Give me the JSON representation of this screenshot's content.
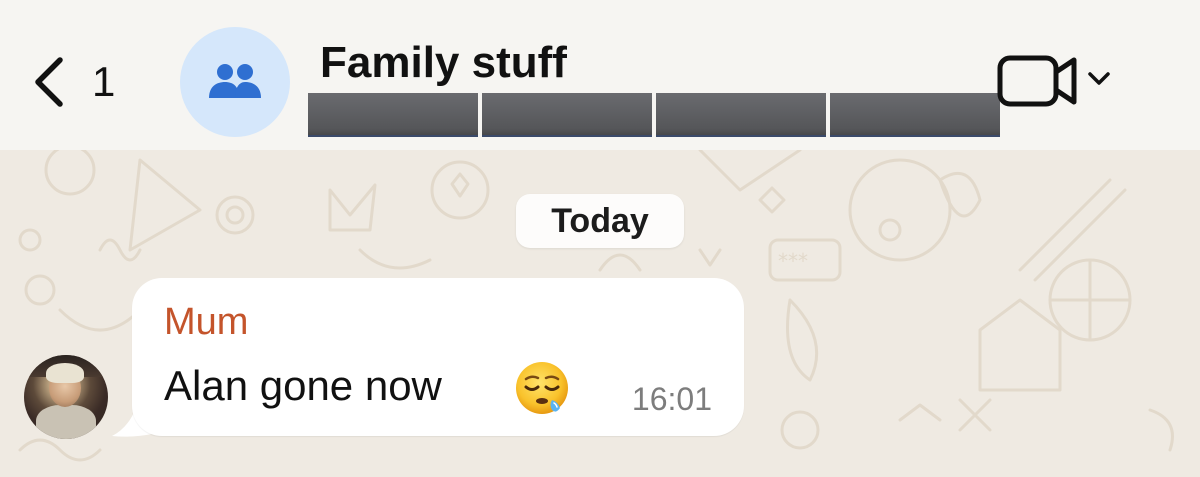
{
  "header": {
    "back_count": "1",
    "title": "Family stuff",
    "avatar_icon": "group-people-icon",
    "video_icon": "video-camera-icon",
    "colors": {
      "background": "#f6f5f2",
      "avatar_bg": "#d5e7fb",
      "avatar_icon": "#2f6fd1"
    }
  },
  "chat": {
    "date_label": "Today",
    "messages": [
      {
        "sender": "Mum",
        "text": "Alan gone now",
        "emoji": "😪",
        "time": "16:01",
        "sender_color": "#c4542b"
      }
    ],
    "wallpaper_color": "#efeae2"
  }
}
